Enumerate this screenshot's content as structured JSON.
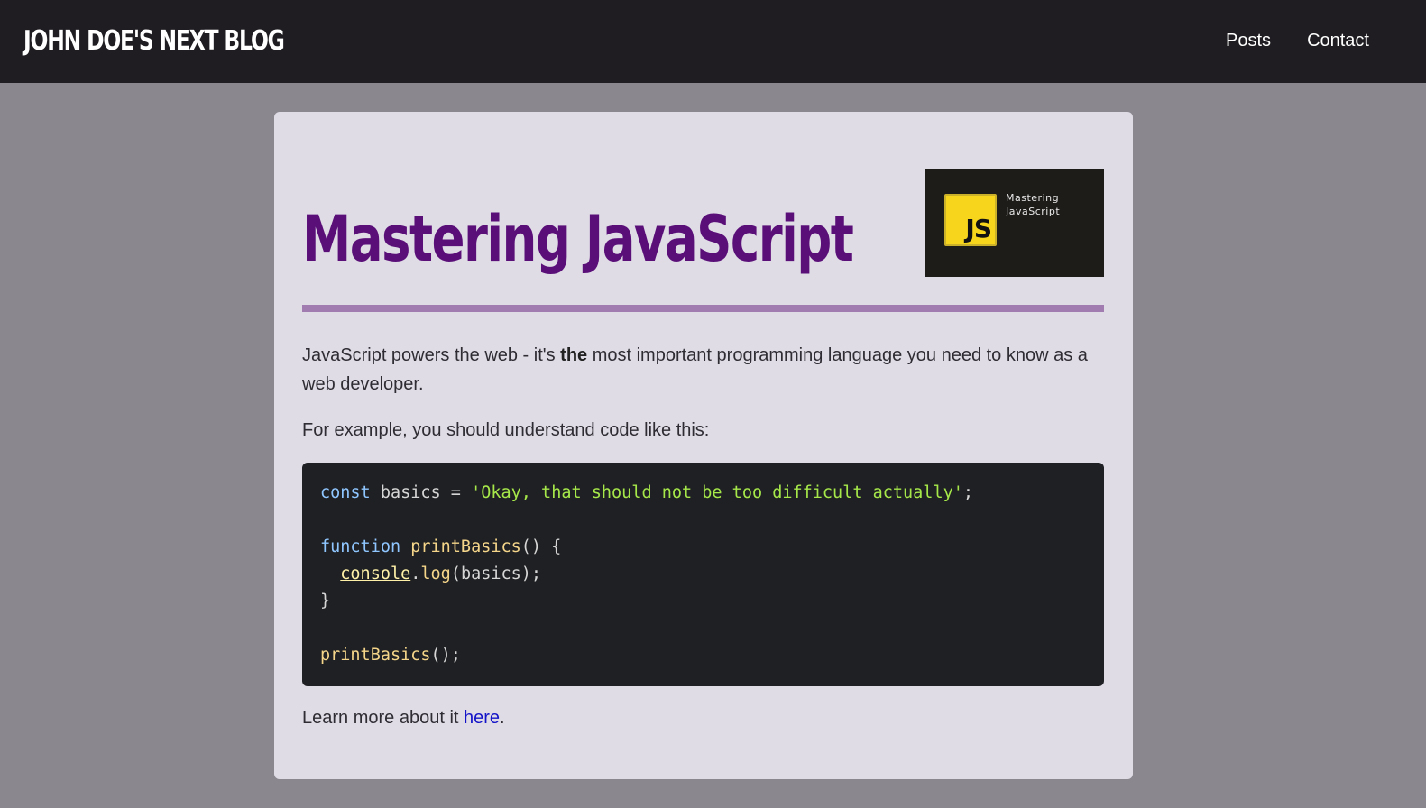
{
  "header": {
    "brand": "JOHN DOE'S NEXT BLOG",
    "nav": [
      "Posts",
      "Contact"
    ]
  },
  "post": {
    "title": "Mastering JavaScript",
    "thumbnail": {
      "badge": "JS",
      "caption_line1": "Mastering",
      "caption_line2": "JavaScript"
    },
    "intro_before": "JavaScript powers the web - it's ",
    "intro_bold": "the",
    "intro_after": " most important programming language you need to know as a web developer.",
    "example_text": "For example, you should understand code like this:",
    "code": {
      "l1_kw": "const",
      "l1_mid": " basics = ",
      "l1_str": "'Okay, that should not be too difficult actually'",
      "l1_end": ";",
      "l3_kw": "function",
      "l3_fn": " printBasics",
      "l3_end": "() {",
      "l4_indent": "  ",
      "l4_obj": "console",
      "l4_dot": ".",
      "l4_fn": "log",
      "l4_end": "(basics);",
      "l5": "}",
      "l7_fn": "printBasics",
      "l7_end": "();"
    },
    "learn_more_before": "Learn more about it ",
    "learn_more_link": "here",
    "learn_more_after": "."
  },
  "colors": {
    "page_bg": "#8a878f",
    "header_bg": "#1f1d21",
    "card_bg": "#dfdce6",
    "title": "#5a0f78",
    "rule": "#a07cb0",
    "code_bg": "#1f2023",
    "link": "#1515c8"
  }
}
